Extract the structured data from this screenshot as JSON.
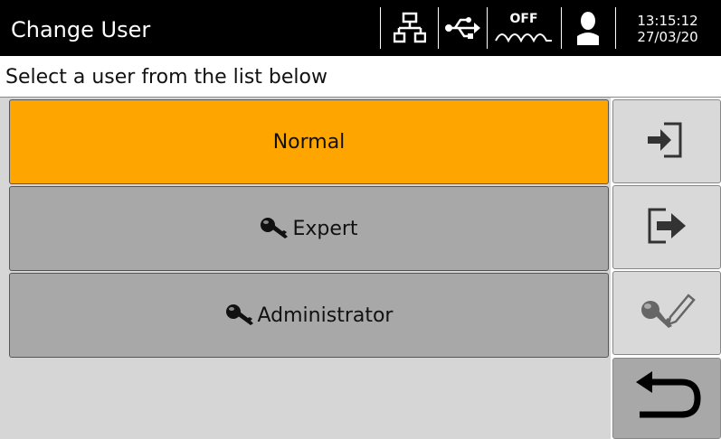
{
  "header": {
    "title": "Change User",
    "status_icons": [
      "network-icon",
      "usb-icon",
      "heater-off-icon",
      "user-icon"
    ],
    "heater_label": "OFF",
    "time": "13:15:12",
    "date": "27/03/20"
  },
  "subtitle": "Select a user from the list below",
  "users": [
    {
      "label": "Normal",
      "selected": true,
      "has_key": false
    },
    {
      "label": "Expert",
      "selected": false,
      "has_key": true
    },
    {
      "label": "Administrator",
      "selected": false,
      "has_key": true
    }
  ],
  "side_buttons": [
    "login-icon",
    "logout-icon",
    "change-password-icon",
    "back-icon"
  ],
  "colors": {
    "selected": "#ffa500",
    "button": "#a8a8a8",
    "side_button": "#d9d9d9",
    "header": "#000000"
  }
}
